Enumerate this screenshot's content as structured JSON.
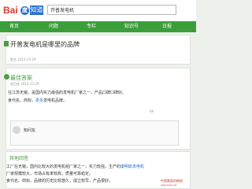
{
  "header": {
    "logo_bai": "Bai",
    "logo_paw": "度",
    "logo_zhidao": "知道",
    "search_value": "开普发电机"
  },
  "nav": {
    "items": [
      "首页",
      "问题",
      "专栏",
      "知识号",
      "日报"
    ]
  },
  "question": {
    "title": "开普发电机是哪里的品牌",
    "meta": "匿名 2015-12-29"
  },
  "best_answer": {
    "heading": "最佳答案",
    "user_meta": "老百姓 2015-12-29",
    "line1": "在江苏无锡，是国内实力最强的发电机厂家之一，产品口碑口碑好。",
    "line2_prefix": "食代名、商标，",
    "line2_link": "更多",
    "line2_suffix": "发电机品牌。",
    "likes": "99"
  },
  "comment": {
    "username": "知问友"
  },
  "other_answers": {
    "heading": "其他回答",
    "line1": "工厂在无锡，国内比较大的发电机组厂家之一，实力较强，生产的",
    "line1_link": "康明斯发电机",
    "line2": "厂家规模较大，市场占有率较高，质量可靠稳定。",
    "line3": "食代名、商标，品牌的历史比较悠久，成立较早，产品很好。"
  },
  "watermark": {
    "line1": "中国路面机械网",
    "line2": "www.lmjx.net"
  }
}
